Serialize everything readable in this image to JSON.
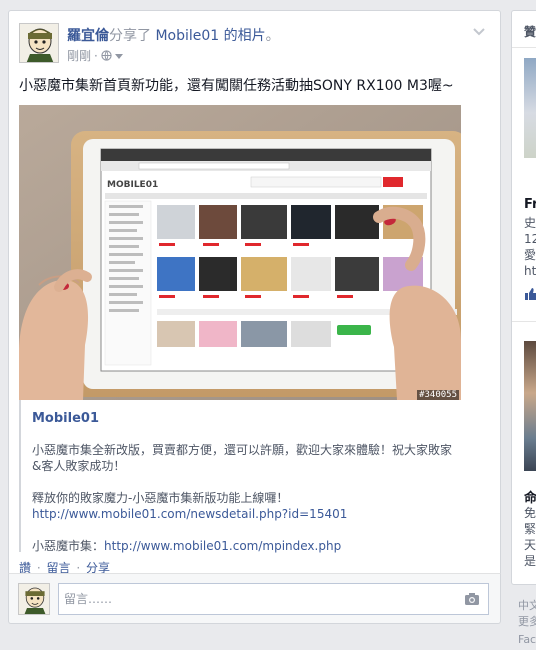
{
  "post": {
    "author": "羅宜倫",
    "verb": "分享了",
    "page_name": "Mobile01",
    "suffix": " 的相片",
    "period": "。",
    "time": "剛剛",
    "message": "小惡魔市集新首頁新功能，還有闖關任務活動抽SONY RX100 M3喔~",
    "photo_watermark": "#340055",
    "photo_alt": "iPad showing Mobile01 小惡魔市集",
    "attachment": {
      "source": "Mobile01",
      "line1": "小惡魔市集全新改版，買賣都方便，還可以許願，歡迎大家來體驗！祝大家敗家",
      "line2": "&客人敗家成功！",
      "line3": "釋放你的敗家魔力-小惡魔市集新版功能上線囉！",
      "link1": "http://www.mobile01.com/newsdetail.php?id=15401",
      "label3": "小惡魔市集：",
      "link2": "http://www.mobile01.com/mpindex.php"
    },
    "actions": {
      "like": "讚",
      "comment": "留言",
      "share": "分享",
      "separator": "·"
    },
    "comment_placeholder": "留言……"
  },
  "sidebar": {
    "header": "贊",
    "item1_title": "Fr",
    "item1_lines": [
      "史",
      "12",
      "愛",
      "htt"
    ],
    "item2_title": "命",
    "item2_lines": [
      "免",
      "緊",
      "天",
      "是"
    ]
  },
  "footer": {
    "line1": "中文",
    "line2": "更多",
    "line3": "Face"
  },
  "colors": {
    "link": "#3b5998",
    "muted": "#9197a3",
    "background": "#e9eaed",
    "card": "#ffffff"
  },
  "icons": [
    "globe-icon",
    "caret-down-icon",
    "chevron-down-icon",
    "camera-icon",
    "thumbs-up-icon"
  ]
}
